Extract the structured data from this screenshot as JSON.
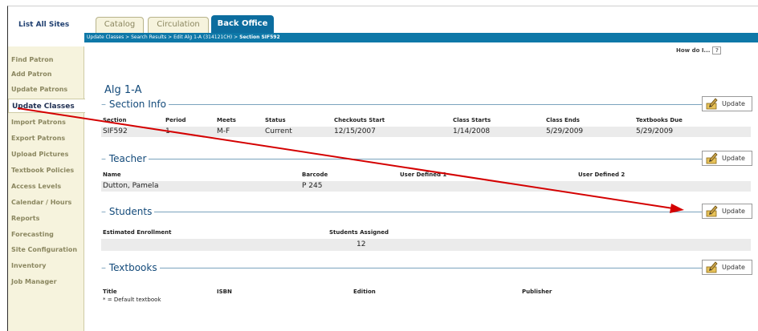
{
  "top": {
    "sites_label": "List All Sites",
    "tabs": [
      "Catalog",
      "Circulation",
      "Back Office"
    ],
    "crumbs": "Update Classes > Search Results > Edit Alg 1-A (314121CH) > ",
    "crumb_current": "Section SIF592"
  },
  "sidebar": {
    "items": [
      "Find Patron",
      "Add Patron",
      "Update Patrons",
      "Update Classes",
      "Import Patrons",
      "Export Patrons",
      "Upload Pictures",
      "Textbook Policies",
      "Access Levels",
      "Calendar / Hours",
      "Reports",
      "Forecasting",
      "Site Configuration",
      "Inventory",
      "Job Manager"
    ]
  },
  "howdo": {
    "label": "How do I...",
    "q": "?"
  },
  "course_title": "Alg 1-A",
  "update_label": "Update",
  "section_info": {
    "title": "Section Info",
    "headers": [
      "Section",
      "Period",
      "Meets",
      "Status",
      "Checkouts Start",
      "Class Starts",
      "Class Ends",
      "Textbooks Due"
    ],
    "values": [
      "SIF592",
      "1",
      "M-F",
      "Current",
      "12/15/2007",
      "1/14/2008",
      "5/29/2009",
      "5/29/2009"
    ]
  },
  "teacher": {
    "title": "Teacher",
    "headers": [
      "Name",
      "Barcode",
      "User Defined 1",
      "User Defined 2"
    ],
    "values": [
      "Dutton, Pamela",
      "P 245"
    ]
  },
  "students": {
    "title": "Students",
    "headers": [
      "Estimated Enrollment",
      "Students Assigned"
    ],
    "values": [
      "12"
    ]
  },
  "textbooks": {
    "title": "Textbooks",
    "headers": [
      "Title",
      "ISBN",
      "Edition",
      "Publisher"
    ],
    "note": "* = Default textbook"
  },
  "colors": {
    "accent": "#0c6d9f",
    "sidebar_bg": "#f6f3dd",
    "arrow": "#d40000"
  }
}
